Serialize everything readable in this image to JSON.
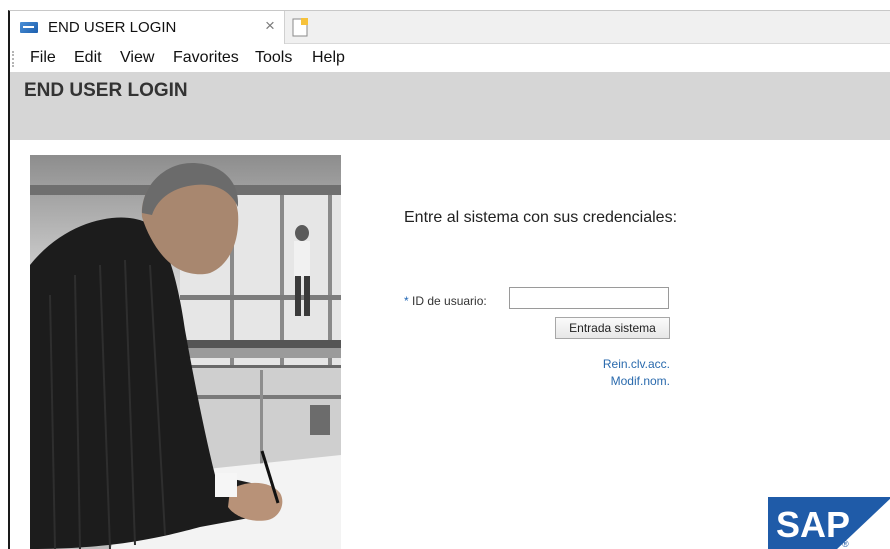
{
  "browser": {
    "tab": {
      "title": "END USER LOGIN",
      "close_glyph": "×",
      "icon": "sap-favicon-icon"
    },
    "new_tab_icon": "new-tab-icon"
  },
  "menubar": {
    "items": [
      {
        "label": "File"
      },
      {
        "label": "Edit"
      },
      {
        "label": "View"
      },
      {
        "label": "Favorites"
      },
      {
        "label": "Tools"
      },
      {
        "label": "Help"
      }
    ]
  },
  "header": {
    "title": "END USER LOGIN"
  },
  "login": {
    "heading": "Entre al sistema con sus credenciales:",
    "required_marker": "*",
    "userid_label": "ID de usuario:",
    "userid_value": "",
    "login_button": "Entrada sistema",
    "links": {
      "reset_password": "Rein.clv.acc.",
      "change_name": "Modif.nom."
    }
  },
  "brand": {
    "logo_text": "SAP",
    "registered": "®",
    "logo_color": "#1f5ba8"
  }
}
